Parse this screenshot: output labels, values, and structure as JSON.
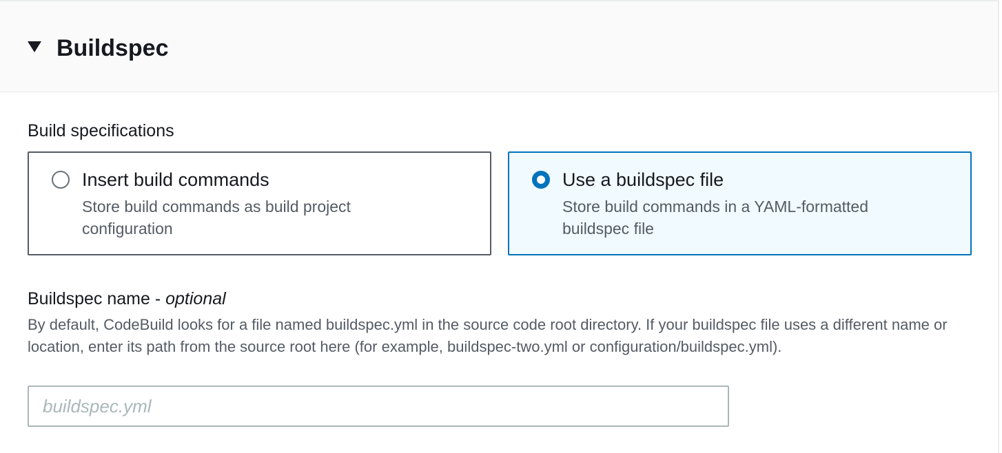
{
  "section": {
    "title": "Buildspec",
    "expanded": true
  },
  "build_specifications": {
    "label": "Build specifications",
    "options": [
      {
        "title": "Insert build commands",
        "description": "Store build commands as build project configuration",
        "selected": false
      },
      {
        "title": "Use a buildspec file",
        "description": "Store build commands in a YAML-formatted buildspec file",
        "selected": true
      }
    ]
  },
  "buildspec_name": {
    "label": "Buildspec name - ",
    "label_optional": "optional",
    "help": "By default, CodeBuild looks for a file named buildspec.yml in the source code root directory. If your buildspec file uses a different name or location, enter its path from the source root here (for example, buildspec-two.yml or configuration/buildspec.yml).",
    "value": "",
    "placeholder": "buildspec.yml"
  },
  "colors": {
    "selected_border": "#0073bb",
    "selected_background": "#f1faff",
    "header_background": "#fafafa",
    "text_primary": "#16191f",
    "text_secondary": "#545b64"
  }
}
